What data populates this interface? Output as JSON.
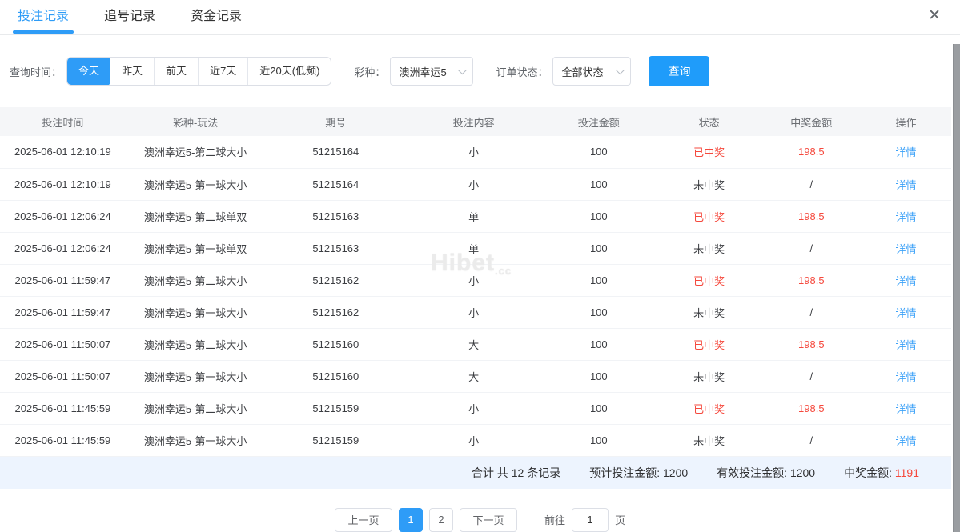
{
  "theme": {
    "primary": "#2E9CF7",
    "danger": "#F5493D",
    "link": "#3BA1F8"
  },
  "tabs": [
    {
      "label": "投注记录",
      "active": true
    },
    {
      "label": "追号记录",
      "active": false
    },
    {
      "label": "资金记录",
      "active": false
    }
  ],
  "close_icon": "✕",
  "filters": {
    "time_label": "查询时间：",
    "time_options": [
      "今天",
      "昨天",
      "前天",
      "近7天",
      "近20天(低频)"
    ],
    "time_active": "今天",
    "lottery_label": "彩种：",
    "lottery_value": "澳洲幸运5",
    "status_label": "订单状态：",
    "status_value": "全部状态",
    "query_button": "查询"
  },
  "table": {
    "headers": [
      "投注时间",
      "彩种-玩法",
      "期号",
      "投注内容",
      "投注金额",
      "状态",
      "中奖金额",
      "操作"
    ],
    "rows": [
      {
        "time": "2025-06-01 12:10:19",
        "game": "澳洲幸运5-第二球大小",
        "issue": "51215164",
        "content": "小",
        "amount": "100",
        "status": "已中奖",
        "won": true,
        "prize": "198.5",
        "action": "详情"
      },
      {
        "time": "2025-06-01 12:10:19",
        "game": "澳洲幸运5-第一球大小",
        "issue": "51215164",
        "content": "小",
        "amount": "100",
        "status": "未中奖",
        "won": false,
        "prize": "/",
        "action": "详情"
      },
      {
        "time": "2025-06-01 12:06:24",
        "game": "澳洲幸运5-第二球单双",
        "issue": "51215163",
        "content": "单",
        "amount": "100",
        "status": "已中奖",
        "won": true,
        "prize": "198.5",
        "action": "详情"
      },
      {
        "time": "2025-06-01 12:06:24",
        "game": "澳洲幸运5-第一球单双",
        "issue": "51215163",
        "content": "单",
        "amount": "100",
        "status": "未中奖",
        "won": false,
        "prize": "/",
        "action": "详情"
      },
      {
        "time": "2025-06-01 11:59:47",
        "game": "澳洲幸运5-第二球大小",
        "issue": "51215162",
        "content": "小",
        "amount": "100",
        "status": "已中奖",
        "won": true,
        "prize": "198.5",
        "action": "详情"
      },
      {
        "time": "2025-06-01 11:59:47",
        "game": "澳洲幸运5-第一球大小",
        "issue": "51215162",
        "content": "小",
        "amount": "100",
        "status": "未中奖",
        "won": false,
        "prize": "/",
        "action": "详情"
      },
      {
        "time": "2025-06-01 11:50:07",
        "game": "澳洲幸运5-第二球大小",
        "issue": "51215160",
        "content": "大",
        "amount": "100",
        "status": "已中奖",
        "won": true,
        "prize": "198.5",
        "action": "详情"
      },
      {
        "time": "2025-06-01 11:50:07",
        "game": "澳洲幸运5-第一球大小",
        "issue": "51215160",
        "content": "大",
        "amount": "100",
        "status": "未中奖",
        "won": false,
        "prize": "/",
        "action": "详情"
      },
      {
        "time": "2025-06-01 11:45:59",
        "game": "澳洲幸运5-第二球大小",
        "issue": "51215159",
        "content": "小",
        "amount": "100",
        "status": "已中奖",
        "won": true,
        "prize": "198.5",
        "action": "详情"
      },
      {
        "time": "2025-06-01 11:45:59",
        "game": "澳洲幸运5-第一球大小",
        "issue": "51215159",
        "content": "小",
        "amount": "100",
        "status": "未中奖",
        "won": false,
        "prize": "/",
        "action": "详情"
      }
    ]
  },
  "watermark": {
    "text": "Hibet",
    "suffix": ".cc"
  },
  "summary": {
    "total_text": "合计 共 12 条记录",
    "expected_label": "预计投注金额:",
    "expected_value": "1200",
    "valid_label": "有效投注金额:",
    "valid_value": "1200",
    "prize_label": "中奖金额:",
    "prize_value": "1191"
  },
  "pagination": {
    "prev": "上一页",
    "pages": [
      "1",
      "2"
    ],
    "active_page": "1",
    "next": "下一页",
    "goto_label": "前往",
    "goto_value": "1",
    "page_unit": "页"
  }
}
